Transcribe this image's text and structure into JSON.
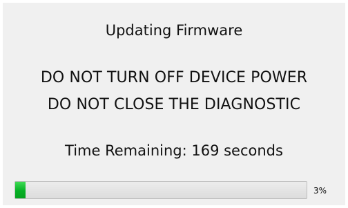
{
  "dialog": {
    "title": "Updating Firmware",
    "warning_line_1": "DO NOT TURN OFF DEVICE POWER",
    "warning_line_2": "DO NOT CLOSE THE DIAGNOSTIC",
    "time_remaining": "Time Remaining: 169 seconds",
    "progress": {
      "percent_label": "3%",
      "fraction": 0.035,
      "fill_color": "#06b025"
    }
  }
}
